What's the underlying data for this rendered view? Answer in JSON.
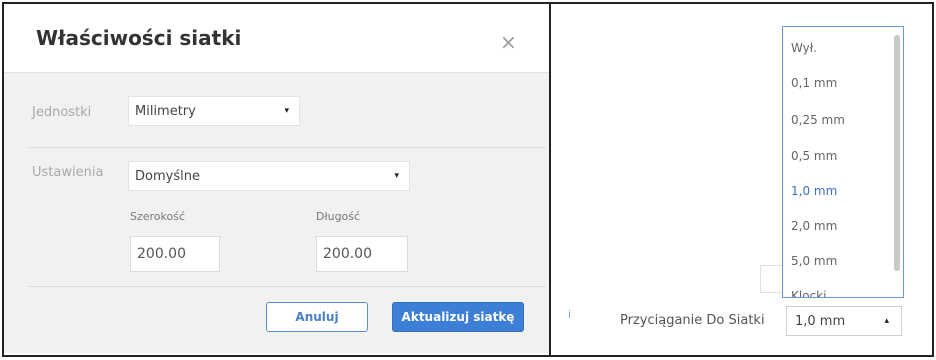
{
  "dialog": {
    "title": "Właściwości siatki",
    "close_glyph": "×",
    "units": {
      "label": "Jednostki",
      "value": "Milimetry"
    },
    "settings": {
      "label": "Ustawienia",
      "value": "Domyślne"
    },
    "width": {
      "label": "Szerokość",
      "value": "200.00"
    },
    "length": {
      "label": "Długość",
      "value": "200.00"
    },
    "cancel_label": "Anuluj",
    "update_label": "Aktualizuj siatkę",
    "caret_glyph": "▾"
  },
  "snap_dropdown": {
    "options": [
      "Wył.",
      "0,1 mm",
      "0,25 mm",
      "0,5 mm",
      "1,0 mm",
      "2,0 mm",
      "5,0 mm",
      "Klocki"
    ],
    "selected_index": 4,
    "label": "Przyciąganie Do Siatki",
    "value": "1,0 mm",
    "caret_glyph": "▴",
    "side_mark": "i"
  },
  "colors": {
    "accent": "#3d7fd6",
    "selected_option": "#3d6fc0",
    "dropdown_border": "#6a9ad8"
  },
  "icons": {
    "close": "close-icon",
    "caret_down": "caret-down-icon",
    "caret_up": "caret-up-icon"
  }
}
